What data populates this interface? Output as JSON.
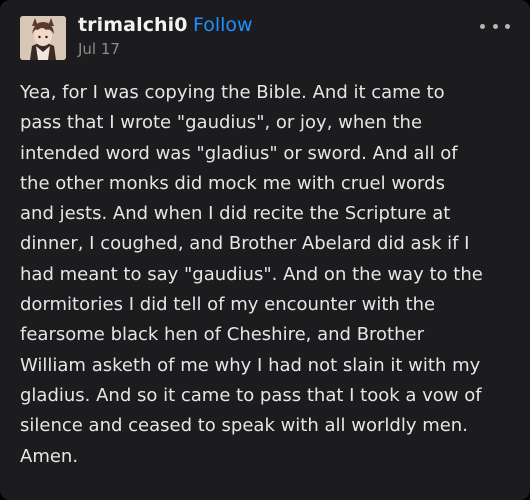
{
  "post": {
    "author": "trimalchi0",
    "follow_label": "Follow",
    "date": "Jul 17",
    "more_icon": "ellipsis-icon",
    "body_lines": [
      "Yea, for I was copying the Bible. And it came to",
      "pass that I wrote \"gaudius\", or joy, when the",
      "intended word was \"gladius\" or sword. And all of",
      "the other monks did mock me with cruel words",
      "and jests. And when I did recite the Scripture at",
      "dinner, I coughed, and Brother Abelard did ask if I",
      "had meant to say \"gaudius\". And on the way to the",
      "dormitories I did tell of my encounter with the",
      "fearsome black hen of Cheshire, and Brother",
      "William asketh of me why I had not slain it with my",
      "gladius. And so it came to pass that I took a vow of",
      "silence and ceased to speak with all worldly men.",
      "Amen."
    ]
  },
  "colors": {
    "background": "#1c1c1e",
    "text": "#e6e6e6",
    "accent": "#1e90ff",
    "muted": "#8c8c8c"
  }
}
